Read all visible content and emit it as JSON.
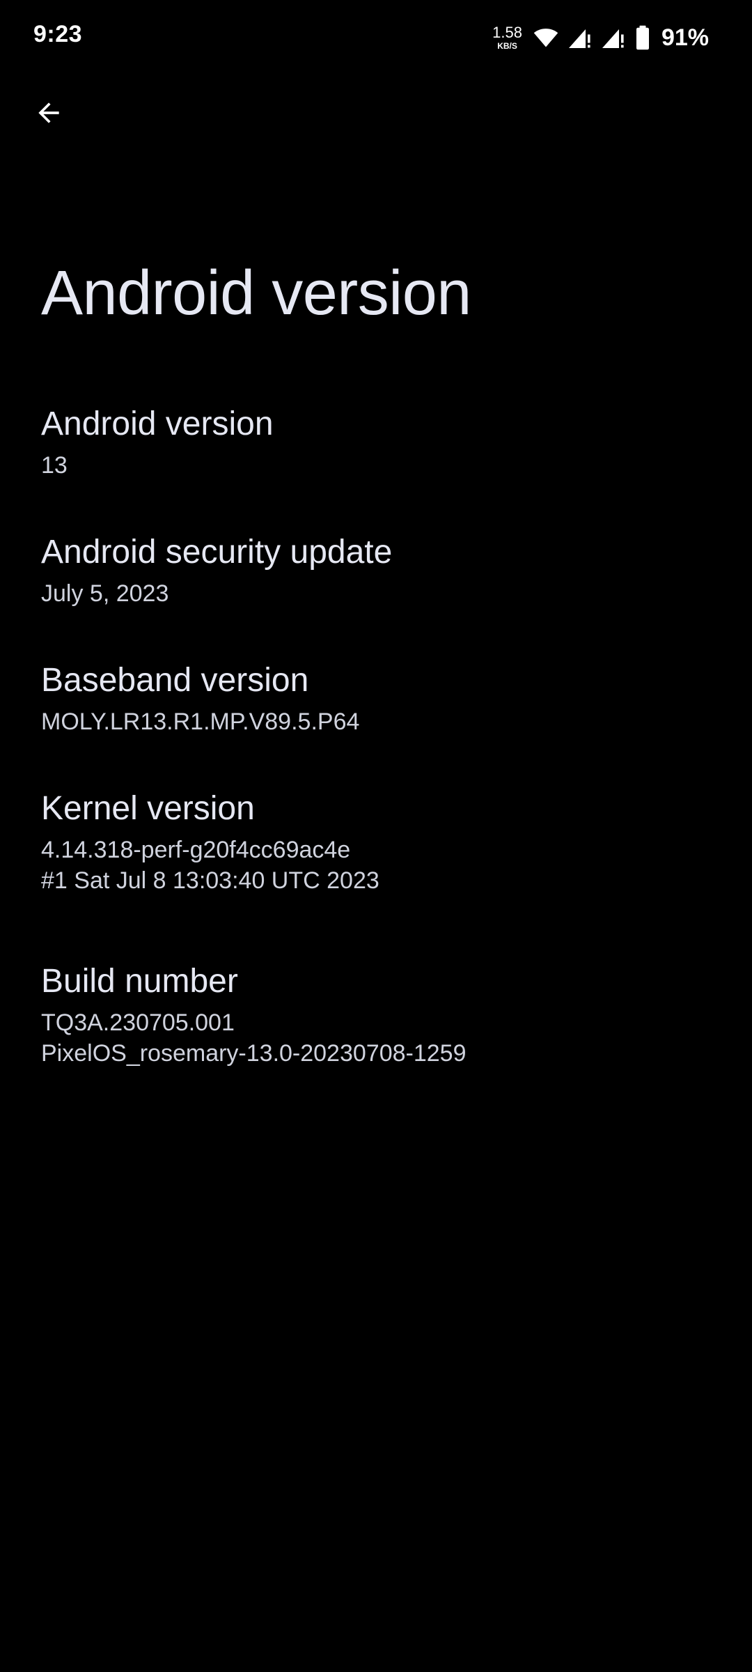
{
  "status_bar": {
    "time": "9:23",
    "net_speed_value": "1.58",
    "net_speed_unit": "KB/S",
    "battery_percent": "91%",
    "icons": [
      "wifi-icon",
      "cell-signal-icon",
      "cell-signal-icon",
      "battery-icon"
    ]
  },
  "header": {
    "back_icon": "arrow-back-icon",
    "title": "Android version"
  },
  "items": [
    {
      "title": "Android version",
      "summary": "13"
    },
    {
      "title": "Android security update",
      "summary": "July 5, 2023"
    },
    {
      "title": "Baseband version",
      "summary": "MOLY.LR13.R1.MP.V89.5.P64"
    },
    {
      "title": "Kernel version",
      "summary_line1": "4.14.318-perf-g20f4cc69ac4e",
      "summary_line2": "#1 Sat Jul 8 13:03:40 UTC 2023"
    },
    {
      "title": "Build number",
      "summary_line1": "TQ3A.230705.001",
      "summary_line2": "PixelOS_rosemary-13.0-20230708-1259"
    }
  ],
  "colors": {
    "background": "#000000",
    "text_primary": "#e6e8f3",
    "text_secondary": "#d0d3de"
  }
}
